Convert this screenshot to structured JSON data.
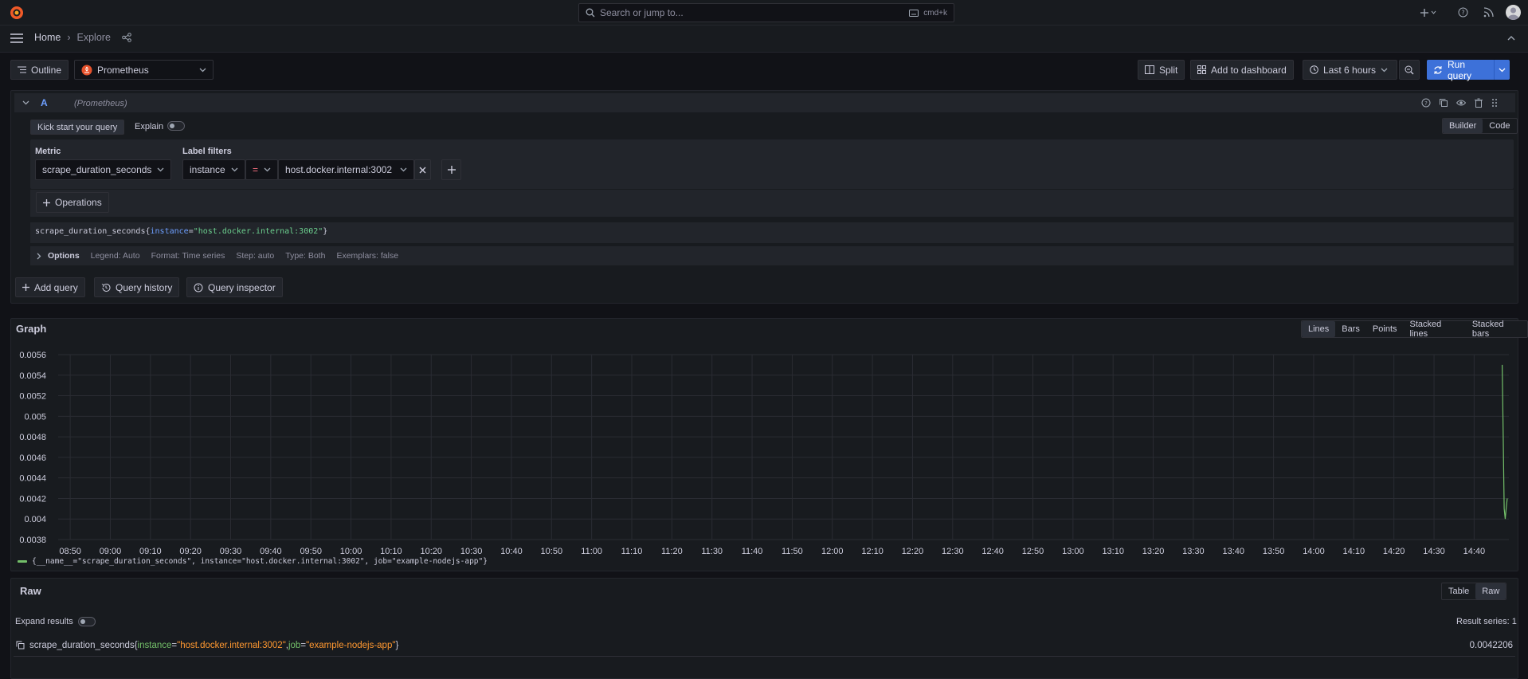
{
  "topbar": {
    "search_placeholder": "Search or jump to...",
    "shortcut": "cmd+k"
  },
  "breadcrumb": {
    "home": "Home",
    "current": "Explore"
  },
  "toolbar": {
    "outline_label": "Outline",
    "datasource": "Prometheus",
    "split_label": "Split",
    "add_to_dashboard_label": "Add to dashboard",
    "time_range": "Last 6 hours",
    "run_query_label": "Run query"
  },
  "query": {
    "ref_id": "A",
    "datasource_hint": "(Prometheus)",
    "kick_start_label": "Kick start your query",
    "explain_label": "Explain",
    "mode_builder": "Builder",
    "mode_code": "Code",
    "metric_label": "Metric",
    "metric_value": "scrape_duration_seconds",
    "label_filters_label": "Label filters",
    "filter_label": "instance",
    "filter_op": "=",
    "filter_value": "host.docker.internal:3002",
    "operations_label": "Operations",
    "preview_metric": "scrape_duration_seconds",
    "preview_open": "{",
    "preview_key": "instance",
    "preview_eq": "=",
    "preview_val": "\"host.docker.internal:3002\"",
    "preview_close": "}",
    "options_label": "Options",
    "options_legend": "Legend: Auto",
    "options_format": "Format: Time series",
    "options_step": "Step: auto",
    "options_type": "Type: Both",
    "options_exemplars": "Exemplars: false"
  },
  "actions": {
    "add_query": "Add query",
    "query_history": "Query history",
    "query_inspector": "Query inspector"
  },
  "graph": {
    "title": "Graph",
    "modes": [
      "Lines",
      "Bars",
      "Points",
      "Stacked lines",
      "Stacked bars"
    ],
    "legend": "{__name__=\"scrape_duration_seconds\", instance=\"host.docker.internal:3002\", job=\"example-nodejs-app\"}",
    "series_color": "#73bf69"
  },
  "chart_data": {
    "type": "line",
    "y_ticks": [
      "0.0056",
      "0.0054",
      "0.0052",
      "0.005",
      "0.0048",
      "0.0046",
      "0.0044",
      "0.0042",
      "0.004",
      "0.0038"
    ],
    "x_ticks": [
      "08:50",
      "09:00",
      "09:10",
      "09:20",
      "09:30",
      "09:40",
      "09:50",
      "10:00",
      "10:10",
      "10:20",
      "10:30",
      "10:40",
      "10:50",
      "11:00",
      "11:10",
      "11:20",
      "11:30",
      "11:40",
      "11:50",
      "12:00",
      "12:10",
      "12:20",
      "12:30",
      "12:40",
      "12:50",
      "13:00",
      "13:10",
      "13:20",
      "13:30",
      "13:40",
      "13:50",
      "14:00",
      "14:10",
      "14:20",
      "14:30",
      "14:40"
    ],
    "ylim": [
      0.0038,
      0.0056
    ],
    "grid": true,
    "series": [
      {
        "x": [
          "14:47:00",
          "14:47:15",
          "14:47:30",
          "14:47:45",
          "14:48:00",
          "14:48:15"
        ],
        "values": [
          0.0055,
          0.0048,
          0.0041,
          0.004,
          0.0041,
          0.0042
        ]
      }
    ]
  },
  "raw": {
    "title": "Raw",
    "modes": [
      "Table",
      "Raw"
    ],
    "expand_label": "Expand results",
    "result_series": "Result series: 1",
    "row_metric": "scrape_duration_seconds",
    "row_open": "{",
    "row_k1": "instance",
    "row_v1": "\"host.docker.internal:3002\"",
    "row_sep": ", ",
    "row_k2": "job",
    "row_v2": "\"example-nodejs-app\"",
    "row_close": "}",
    "row_eq": "=",
    "row_value": "0.0042206"
  }
}
